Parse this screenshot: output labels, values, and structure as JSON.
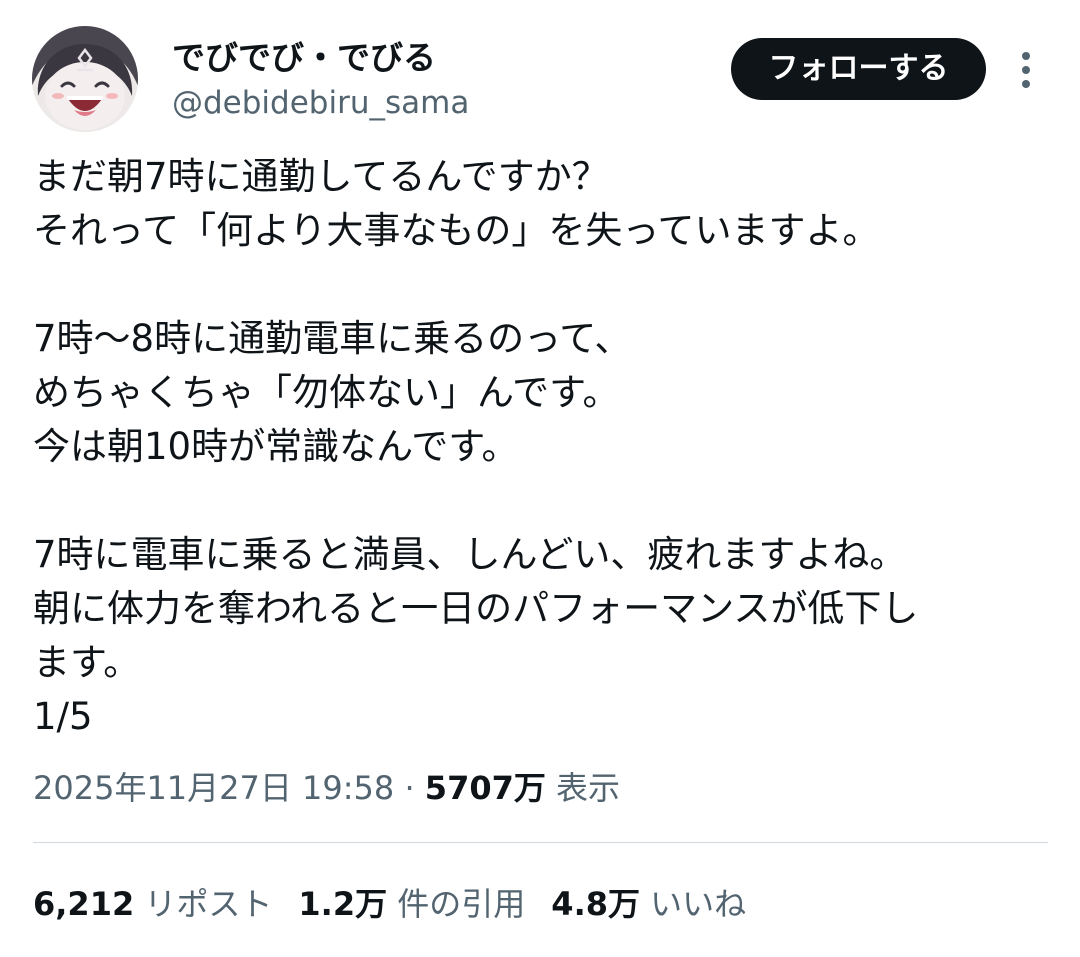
{
  "user": {
    "display_name": "でびでび・でびる",
    "handle": "@debidebiru_sama"
  },
  "actions": {
    "follow_label": "フォローする",
    "more_icon": "more-vertical-icon"
  },
  "tweet": {
    "paragraphs": [
      [
        "まだ朝7時に通勤してるんですか？",
        "それって「何より大事なもの」を失っていますよ。"
      ],
      [
        "7時〜8時に通勤電車に乗るのって、",
        "めちゃくちゃ「勿体ない」んです。",
        "今は朝10時が常識なんです。"
      ],
      [
        "7時に電車に乗ると満員、しんどい、疲れますよね。",
        "朝に体力を奪われると一日のパフォーマンスが低下し",
        "ます。",
        "1/5"
      ]
    ]
  },
  "meta": {
    "timestamp": "2025年11月27日 19:58",
    "separator": " · ",
    "views_count": "5707万",
    "views_label": " 表示"
  },
  "stats": {
    "reposts_count": "6,212",
    "reposts_label": " リポスト",
    "quotes_count": "1.2万",
    "quotes_label": " 件の引用",
    "likes_count": "4.8万",
    "likes_label": " いいね"
  },
  "colors": {
    "text": "#0f1419",
    "secondary": "#536471",
    "divider": "#cfd9de",
    "button_bg": "#0f1419"
  }
}
